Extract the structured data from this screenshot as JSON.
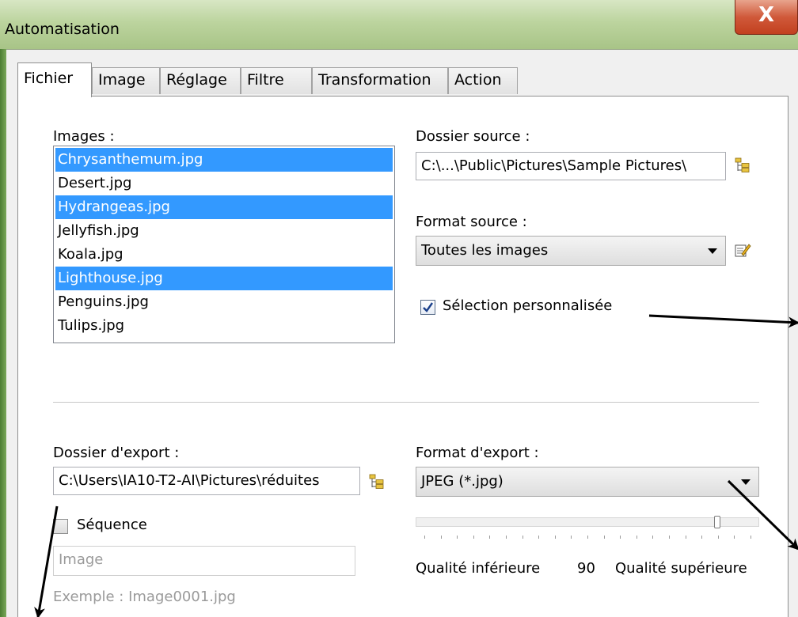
{
  "window": {
    "title": "Automatisation",
    "close_label": "X"
  },
  "tabs": [
    {
      "label": "Fichier"
    },
    {
      "label": "Image"
    },
    {
      "label": "Réglage"
    },
    {
      "label": "Filtre"
    },
    {
      "label": "Transformation"
    },
    {
      "label": "Action"
    }
  ],
  "images": {
    "label": "Images :",
    "items": [
      {
        "name": "Chrysanthemum.jpg",
        "selected": true
      },
      {
        "name": "Desert.jpg",
        "selected": false
      },
      {
        "name": "Hydrangeas.jpg",
        "selected": true
      },
      {
        "name": "Jellyfish.jpg",
        "selected": false
      },
      {
        "name": "Koala.jpg",
        "selected": false
      },
      {
        "name": "Lighthouse.jpg",
        "selected": true
      },
      {
        "name": "Penguins.jpg",
        "selected": false
      },
      {
        "name": "Tulips.jpg",
        "selected": false
      }
    ]
  },
  "source": {
    "folder_label": "Dossier source :",
    "folder_value": "C:\\...\\Public\\Pictures\\Sample Pictures\\",
    "format_label": "Format source :",
    "format_value": "Toutes les images",
    "custom_selection_label": "Sélection personnalisée",
    "custom_selection_checked": true
  },
  "export": {
    "folder_label": "Dossier d'export :",
    "folder_value": "C:\\Users\\IA10-T2-AI\\Pictures\\réduites",
    "format_label": "Format d'export :",
    "format_value": "JPEG (*.jpg)",
    "sequence_label": "Séquence",
    "sequence_checked": false,
    "sequence_placeholder": "Image",
    "example_text": "Exemple : Image0001.jpg",
    "quality_low_label": "Qualité inférieure",
    "quality_value": "90",
    "quality_high_label": "Qualité supérieure"
  },
  "colors": {
    "selection": "#3399ff",
    "title_gradient_top": "#d8e6c4",
    "close_red": "#c2401f"
  },
  "icons": {
    "browse": "folder-tree-icon",
    "edit": "edit-icon"
  }
}
